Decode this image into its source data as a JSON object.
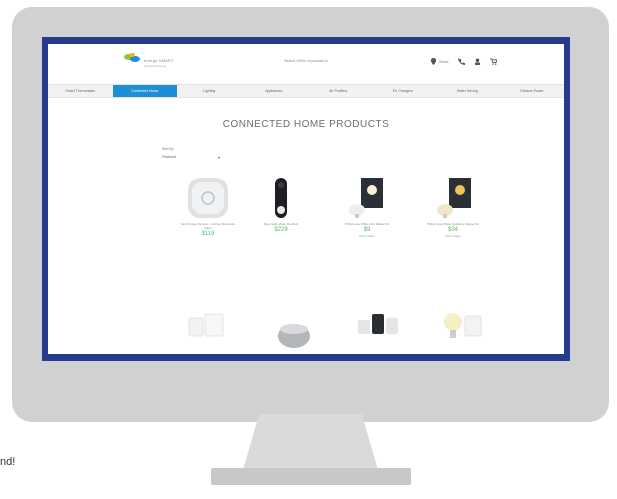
{
  "header": {
    "logo_text": "energy SMART",
    "logo_sub": "connected home",
    "search_placeholder": "Search 1000s of products in",
    "location": "Store",
    "accent_color": "#263b8c"
  },
  "nav": {
    "items": [
      {
        "label": "Smart Thermostats",
        "active": false
      },
      {
        "label": "Connected Home",
        "active": true
      },
      {
        "label": "Lighting",
        "active": false
      },
      {
        "label": "Appliances",
        "active": false
      },
      {
        "label": "Air Purifiers",
        "active": false
      },
      {
        "label": "EV Chargers",
        "active": false
      },
      {
        "label": "Water Saving",
        "active": false
      },
      {
        "label": "Outdoor Power",
        "active": false
      }
    ],
    "active_color": "#1e8fd6"
  },
  "page": {
    "title": "CONNECTED HOME PRODUCTS",
    "sort_label": "Sort By",
    "sort_value": "Featured"
  },
  "products": [
    {
      "desc": "Nest Protect Smoke + Carbon Monoxide Alarm",
      "price": "$119",
      "note": ""
    },
    {
      "desc": "Nest Hello Video Doorbell",
      "price": "$229",
      "note": ""
    },
    {
      "desc": "Philips Hue White A19 Starter Kit",
      "price": "$9",
      "note": "Plus rebate"
    },
    {
      "desc": "Philips Hue White Ambiance Starter Kit",
      "price": "$34",
      "note": "Plus rebate"
    }
  ],
  "footer_text": "nd!"
}
